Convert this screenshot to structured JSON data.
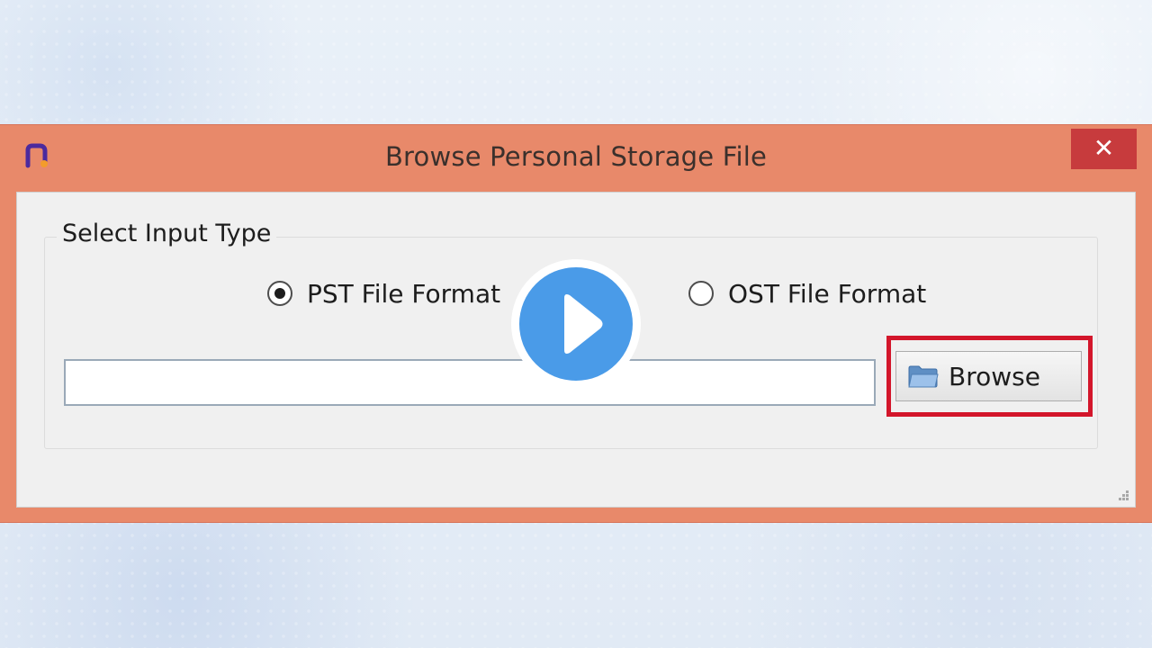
{
  "window": {
    "title": "Browse Personal Storage File",
    "close_symbol": "✕",
    "logo_icon": "app-logo-icon",
    "title_bar_color": "#e8896a",
    "close_color": "#c73b3d"
  },
  "group": {
    "legend": "Select Input Type",
    "options": [
      {
        "label": "PST File Format",
        "checked": true
      },
      {
        "label": "OST File Format",
        "checked": false
      }
    ]
  },
  "path_input": {
    "value": "",
    "placeholder": ""
  },
  "browse": {
    "label": "Browse",
    "icon": "folder-icon",
    "highlight_color": "#d3162b"
  },
  "video_overlay": {
    "icon": "play-icon",
    "color": "#4a9be8"
  }
}
